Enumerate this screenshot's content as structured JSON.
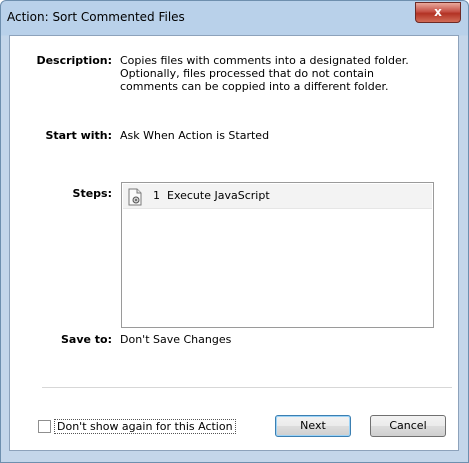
{
  "window": {
    "title": "Action: Sort Commented Files",
    "close_glyph": "x"
  },
  "details": {
    "description_label": "Description:",
    "description_value": "Copies files with comments into a designated folder.  Optionally, files processed that do not contain comments can be coppied into a different folder.",
    "start_label": "Start with:",
    "start_value": "Ask When Action is Started",
    "steps_label": "Steps:",
    "steps": [
      {
        "number": "1",
        "label": "Execute JavaScript",
        "icon": "javascript-script-icon"
      }
    ],
    "saveto_label": "Save to:",
    "saveto_value": "Don't Save Changes"
  },
  "footer": {
    "dont_show_label": "Don't show again for this Action",
    "dont_show_checked": false,
    "next_label": "Next",
    "cancel_label": "Cancel"
  }
}
